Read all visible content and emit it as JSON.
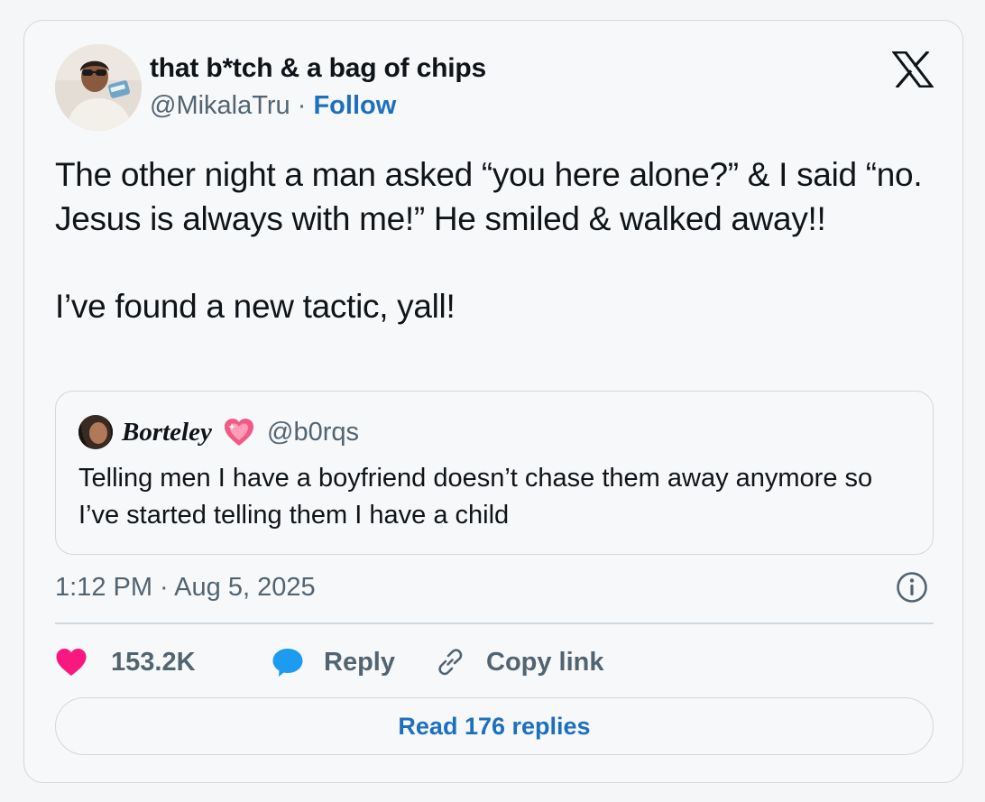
{
  "author": {
    "display_name": "that b*tch & a bag of chips",
    "handle": "@MikalaTru",
    "separator": "·",
    "follow_label": "Follow"
  },
  "tweet": {
    "text": "The other night a man asked “you here alone?” & I said “no. Jesus is always with me!” He smiled & walked away!!\n\nI’ve found a new tactic, yall!",
    "timestamp": "1:12 PM · Aug 5, 2025"
  },
  "quoted_tweet": {
    "display_name": "Borteley",
    "handle": "@b0rqs",
    "text": "Telling men I have a boyfriend doesn’t chase them away anymore so I’ve started telling them I have a child"
  },
  "actions": {
    "like_count": "153.2K",
    "reply_label": "Reply",
    "copy_link_label": "Copy link",
    "read_replies_label": "Read 176 replies"
  },
  "icons": {
    "platform_logo": "x-logo-icon",
    "info": "info-icon",
    "like": "heart-icon",
    "reply": "speech-bubble-icon",
    "copy_link": "link-icon",
    "name_emoji": "sparkling-heart-icon"
  },
  "colors": {
    "link_blue": "#1d6fc0",
    "heart_pink": "#f91880",
    "reply_blue": "#1d9bf0",
    "muted_text": "#536471",
    "border": "#cfd9de"
  }
}
